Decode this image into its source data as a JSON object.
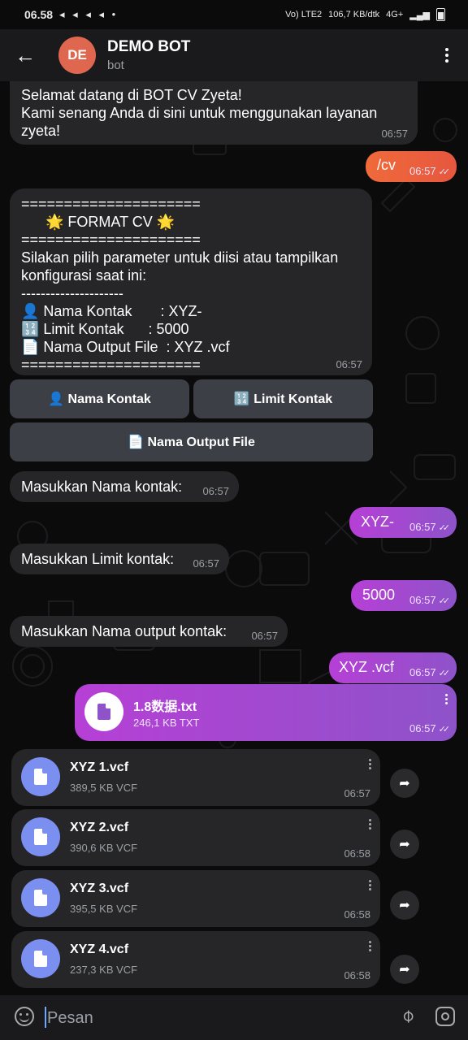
{
  "status_bar": {
    "time": "06.58",
    "left_icons": "◂ ◂ ◂ ◂ •",
    "network": "Vo) LTE2",
    "speed": "106,7 KB/dtk",
    "signal": "4G+"
  },
  "header": {
    "avatar_initials": "DE",
    "title": "DEMO BOT",
    "subtitle": "bot",
    "avatar_color": "#e0674f"
  },
  "messages": {
    "welcome": {
      "text": "Selamat datang di BOT CV Zyeta!\nKami senang Anda di sini untuk menggunakan layanan zyeta!",
      "time": "06:57"
    },
    "cv_cmd": {
      "text": "/cv",
      "time": "06:57"
    },
    "format": {
      "text": "=====================\n      🌟 FORMAT CV 🌟\n=====================\nSilakan pilih parameter untuk diisi atau tampilkan konfigurasi saat ini:\n---------------------\n👤 Nama Kontak       : XYZ-\n🔢 Limit Kontak      : 5000\n📄 Nama Output File  : XYZ .vcf\n=====================",
      "time": "06:57"
    },
    "ask_name": {
      "text": "Masukkan Nama kontak:",
      "time": "06:57"
    },
    "reply_name": {
      "text": "XYZ-",
      "time": "06:57"
    },
    "ask_limit": {
      "text": "Masukkan Limit kontak:",
      "time": "06:57"
    },
    "reply_limit": {
      "text": "5000",
      "time": "06:57"
    },
    "ask_output": {
      "text": "Masukkan Nama output kontak:",
      "time": "06:57"
    },
    "reply_output": {
      "text": "XYZ .vcf",
      "time": "06:57"
    }
  },
  "keyboard": {
    "nama_kontak": "👤 Nama Kontak",
    "limit_kontak": "🔢 Limit Kontak",
    "nama_output": "📄 Nama Output File"
  },
  "sent_file": {
    "name": "1.8数据.txt",
    "size": "246,1 KB TXT",
    "time": "06:57"
  },
  "files": [
    {
      "name": "XYZ 1.vcf",
      "size": "389,5 KB VCF",
      "time": "06:57"
    },
    {
      "name": "XYZ 2.vcf",
      "size": "390,6 KB VCF",
      "time": "06:58"
    },
    {
      "name": "XYZ 3.vcf",
      "size": "395,5 KB VCF",
      "time": "06:58"
    },
    {
      "name": "XYZ 4.vcf",
      "size": "237,3 KB VCF",
      "time": "06:58"
    }
  ],
  "input": {
    "placeholder": "Pesan"
  },
  "read_checks": "✓✓"
}
